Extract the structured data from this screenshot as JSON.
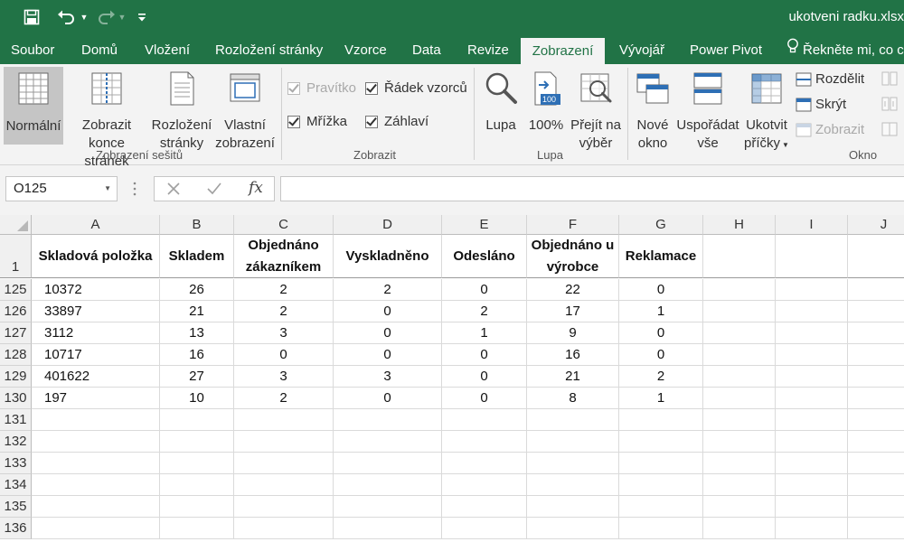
{
  "app": {
    "filename": "ukotveni radku.xlsx",
    "accent_color": "#217346"
  },
  "quick_access": {
    "save_icon": "save-icon",
    "undo_icon": "undo-icon",
    "redo_icon": "redo-icon",
    "customize_icon": "customize-quick-access-icon"
  },
  "tabs": [
    {
      "label": "Soubor"
    },
    {
      "label": "Domů"
    },
    {
      "label": "Vložení"
    },
    {
      "label": "Rozložení stránky"
    },
    {
      "label": "Vzorce"
    },
    {
      "label": "Data"
    },
    {
      "label": "Revize"
    },
    {
      "label": "Zobrazení",
      "active": true
    },
    {
      "label": "Vývojář"
    },
    {
      "label": "Power Pivot"
    }
  ],
  "tell_me": "Řekněte mi, co ch",
  "ribbon": {
    "views_group": {
      "label": "Zobrazení sešitů",
      "normal": "Normální",
      "page_break_l1": "Zobrazit",
      "page_break_l2": "konce stránek",
      "page_layout_l1": "Rozložení",
      "page_layout_l2": "stránky",
      "custom_l1": "Vlastní",
      "custom_l2": "zobrazení"
    },
    "show_group": {
      "label": "Zobrazit",
      "ruler": "Pravítko",
      "formula_bar": "Řádek vzorců",
      "gridlines": "Mřížka",
      "headings": "Záhlaví"
    },
    "zoom_group": {
      "label": "Lupa",
      "zoom": "Lupa",
      "zoom100": "100%",
      "zoom_sel_l1": "Přejít na",
      "zoom_sel_l2": "výběr",
      "icon_100_text": "100"
    },
    "window_group": {
      "label": "Okno",
      "new_l1": "Nové",
      "new_l2": "okno",
      "arrange_l1": "Uspořádat",
      "arrange_l2": "vše",
      "freeze_l1": "Ukotvit",
      "freeze_l2": "příčky",
      "split": "Rozdělit",
      "hide": "Skrýt",
      "unhide": "Zobrazit"
    }
  },
  "formula_bar": {
    "name_box": "O125",
    "fx": "fx",
    "value": ""
  },
  "columns": [
    "A",
    "B",
    "C",
    "D",
    "E",
    "F",
    "G",
    "H",
    "I",
    "J"
  ],
  "header_row": {
    "number": "1",
    "cells": [
      "Skladová položka",
      "Skladem",
      "Objednáno zákazníkem",
      "Vyskladněno",
      "Odesláno",
      "Objednáno u výrobce",
      "Reklamace"
    ]
  },
  "rows": [
    {
      "number": "125",
      "cells": [
        "10372",
        "26",
        "2",
        "2",
        "0",
        "22",
        "0"
      ]
    },
    {
      "number": "126",
      "cells": [
        "33897",
        "21",
        "2",
        "0",
        "2",
        "17",
        "1"
      ]
    },
    {
      "number": "127",
      "cells": [
        "3112",
        "13",
        "3",
        "0",
        "1",
        "9",
        "0"
      ]
    },
    {
      "number": "128",
      "cells": [
        "10717",
        "16",
        "0",
        "0",
        "0",
        "16",
        "0"
      ]
    },
    {
      "number": "129",
      "cells": [
        "401622",
        "27",
        "3",
        "3",
        "0",
        "21",
        "2"
      ]
    },
    {
      "number": "130",
      "cells": [
        "197",
        "10",
        "2",
        "0",
        "0",
        "8",
        "1"
      ]
    },
    {
      "number": "131",
      "cells": []
    },
    {
      "number": "132",
      "cells": []
    },
    {
      "number": "133",
      "cells": []
    },
    {
      "number": "134",
      "cells": []
    },
    {
      "number": "135",
      "cells": []
    },
    {
      "number": "136",
      "cells": []
    }
  ]
}
